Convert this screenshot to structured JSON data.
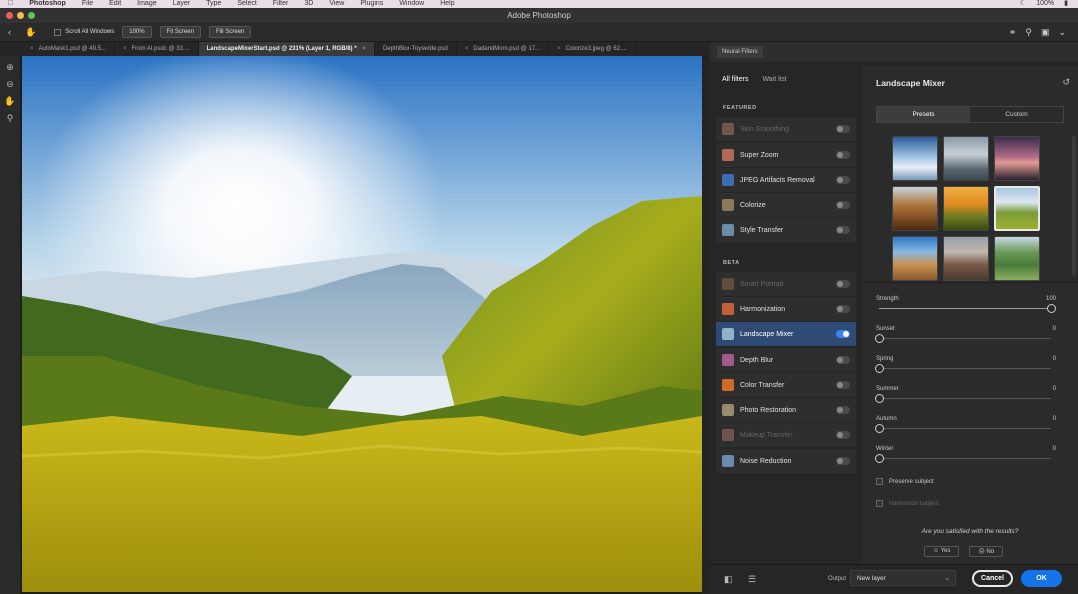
{
  "menubar": {
    "items": [
      "Photoshop",
      "File",
      "Edit",
      "Image",
      "Layer",
      "Type",
      "Select",
      "Filter",
      "3D",
      "View",
      "Plugins",
      "Window",
      "Help"
    ],
    "battery": "100%"
  },
  "window": {
    "title": "Adobe Photoshop"
  },
  "options_bar": {
    "scroll_all": "Scroll All Windows",
    "zoom_100": "100%",
    "fit_screen": "Fit Screen",
    "fill_screen": "Fill Screen"
  },
  "tabs": [
    {
      "label": "AutoMask1.psd @ 49.5..."
    },
    {
      "label": "From AI.psdc @ 33...."
    },
    {
      "label": "LandscapeMixerStart.psd @ 231% (Layer 1, RGB/8) *"
    },
    {
      "label": "DepthBlur-Toyswide.psd"
    },
    {
      "label": "DadandMom.psd @ 17..."
    },
    {
      "label": "Colorize3.jpeg @ 62...."
    }
  ],
  "neural": {
    "panel_title": "Neural Filters",
    "tab_all": "All filters",
    "tab_wait": "Wait list",
    "featured_label": "FEATURED",
    "beta_label": "BETA",
    "featured": [
      {
        "label": "Skin Smoothing",
        "dim": true
      },
      {
        "label": "Super Zoom"
      },
      {
        "label": "JPEG Artifacts Removal"
      },
      {
        "label": "Colorize"
      },
      {
        "label": "Style Transfer"
      }
    ],
    "beta": [
      {
        "label": "Smart Portrait",
        "dim": true
      },
      {
        "label": "Harmonization"
      },
      {
        "label": "Landscape Mixer",
        "selected": true
      },
      {
        "label": "Depth Blur"
      },
      {
        "label": "Color Transfer"
      },
      {
        "label": "Photo Restoration"
      },
      {
        "label": "Makeup Transfer",
        "dim": true
      },
      {
        "label": "Noise Reduction"
      }
    ]
  },
  "mixer": {
    "title": "Landscape Mixer",
    "presets_tab": "Presets",
    "custom_tab": "Custom",
    "sliders": [
      {
        "label": "Strength",
        "value": "100",
        "fraction": 1.0
      },
      {
        "label": "Sunset",
        "value": "0",
        "fraction": 0
      },
      {
        "label": "Spring",
        "value": "0",
        "fraction": 0
      },
      {
        "label": "Summer",
        "value": "0",
        "fraction": 0
      },
      {
        "label": "Autumn",
        "value": "0",
        "fraction": 0
      },
      {
        "label": "Winter",
        "value": "0",
        "fraction": 0
      }
    ],
    "preserve_subject": "Preserve subject",
    "harmonize_subject": "Harmonize subject",
    "satisfied_q": "Are you satisfied with the results?",
    "yes": "Yes",
    "no": "No"
  },
  "footer": {
    "output_label": "Output",
    "output_value": "New layer",
    "cancel": "Cancel",
    "ok": "OK"
  },
  "colors": {
    "accent_blue": "#1473e6",
    "selected_row": "#2f4a74",
    "panel_bg": "#262626"
  }
}
